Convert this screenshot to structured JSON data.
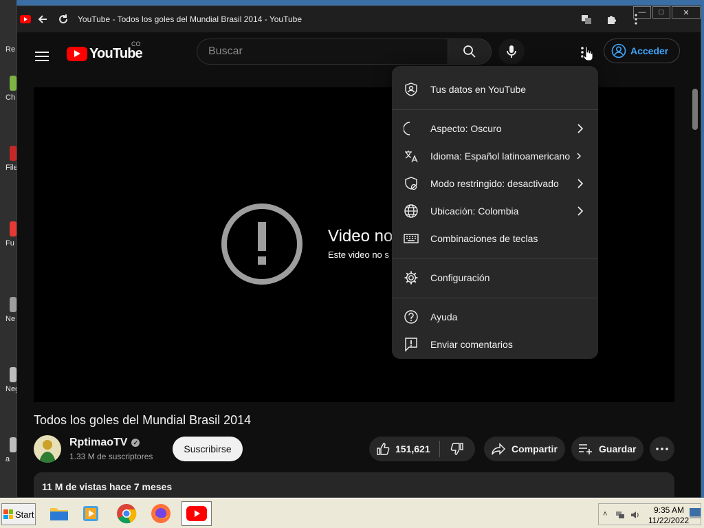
{
  "window": {
    "title": "YouTube - Todos los goles del Mundial Brasil 2014 - YouTube"
  },
  "desktop": {
    "icons": [
      "Re",
      "Ch",
      "File",
      "Fu",
      "Ne",
      "Neg",
      "a"
    ]
  },
  "header": {
    "logo_text": "YouTube",
    "country_code": "CO",
    "search_placeholder": "Buscar",
    "signin_label": "Acceder"
  },
  "player": {
    "error_title": "Video no",
    "error_subtitle": "Este video no s"
  },
  "video": {
    "title": "Todos los goles del Mundial Brasil 2014",
    "channel": "RptimaoTV",
    "subscribers": "1.33 M de suscriptores",
    "subscribe_label": "Suscribirse",
    "likes": "151,621",
    "share_label": "Compartir",
    "save_label": "Guardar",
    "views_date": "11 M de vistas  hace 7 meses"
  },
  "menu": {
    "items": [
      {
        "label": "Tus datos en YouTube",
        "icon": "user-shield-icon"
      },
      {
        "label": "Aspecto: Oscuro",
        "icon": "moon-icon"
      },
      {
        "label": "Idioma: Español latinoamericano",
        "icon": "translate-icon"
      },
      {
        "label": "Modo restringido: desactivado",
        "icon": "restricted-shield-icon"
      },
      {
        "label": "Ubicación: Colombia",
        "icon": "globe-icon"
      },
      {
        "label": "Combinaciones de teclas",
        "icon": "keyboard-icon"
      },
      {
        "label": "Configuración",
        "icon": "gear-icon"
      },
      {
        "label": "Ayuda",
        "icon": "help-icon"
      },
      {
        "label": "Enviar comentarios",
        "icon": "feedback-icon"
      }
    ]
  },
  "taskbar": {
    "start_label": "Start",
    "time": "9:35 AM",
    "date": "11/22/2022"
  },
  "colors": {
    "accent_red": "#ff0000",
    "link_blue": "#3ea6ff",
    "bg_dark": "#0f0f0f",
    "menu_bg": "#282828"
  }
}
